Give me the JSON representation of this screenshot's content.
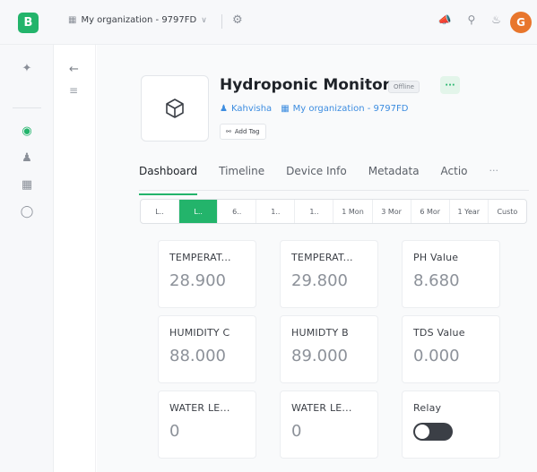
{
  "topbar": {
    "logo_letter": "B",
    "org_name": "My organization - 9797FD",
    "chevron": "∨",
    "icons": [
      "megaphone-icon",
      "globe-icon",
      "bell-icon"
    ],
    "avatar_letter": "G"
  },
  "device": {
    "title": "Hydroponic Monitor",
    "status": "Offline",
    "more": "···",
    "owner": "Kahvisha",
    "organization": "My organization - 9797FD",
    "add_tag": "Add Tag"
  },
  "tabs": [
    "Dashboard",
    "Timeline",
    "Device Info",
    "Metadata",
    "Actio"
  ],
  "tabs_more": "···",
  "active_tab": "Dashboard",
  "ranges": [
    "L..",
    "L..",
    "6..",
    "1..",
    "1..",
    "1 Mon",
    "3 Mor",
    "6 Mor",
    "1 Year",
    "Custo"
  ],
  "active_range_index": 1,
  "widgets": [
    {
      "label": "TEMPERAT...",
      "value": "28.900"
    },
    {
      "label": "TEMPERAT...",
      "value": "29.800"
    },
    {
      "label": "PH Value",
      "value": "8.680"
    },
    {
      "label": "HUMIDITY C",
      "value": "88.000"
    },
    {
      "label": "HUMIDTY B",
      "value": "89.000"
    },
    {
      "label": "TDS Value",
      "value": "0.000"
    },
    {
      "label": "WATER LE...",
      "value": "0"
    },
    {
      "label": "WATER LE...",
      "value": "0"
    },
    {
      "label": "Relay",
      "value": null
    }
  ],
  "relay_on": false,
  "colors": {
    "accent": "#23b46b",
    "link": "#3d8de0",
    "avatar": "#e8762c"
  }
}
